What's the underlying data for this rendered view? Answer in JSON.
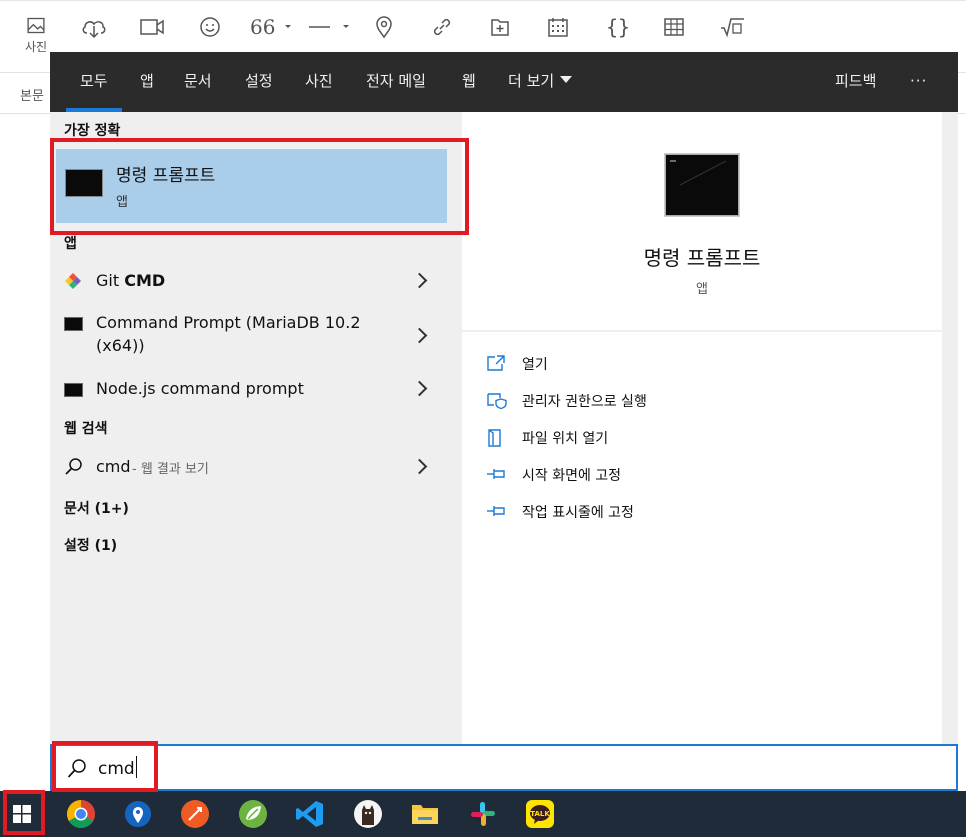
{
  "editor_toolbar": {
    "photo_label": "사진",
    "subbar_label": "본문"
  },
  "start_menu": {
    "tabs": [
      {
        "label": "모두"
      },
      {
        "label": "앱"
      },
      {
        "label": "문서"
      },
      {
        "label": "설정"
      },
      {
        "label": "사진"
      },
      {
        "label": "전자 메일"
      },
      {
        "label": "웹"
      },
      {
        "label": "더 보기"
      }
    ],
    "feedback_label": "피드백",
    "more_label": "···",
    "best_match": {
      "heading": "가장 정확",
      "name": "명령 프롬프트",
      "type": "앱"
    },
    "apps": {
      "heading": "앱",
      "items": [
        {
          "name_prefix": "Git ",
          "name_bold": "CMD"
        },
        {
          "line1": "Command Prompt (MariaDB 10.2",
          "line2": "(x64))"
        },
        {
          "name": "Node.js command prompt"
        }
      ]
    },
    "web_search": {
      "heading": "웹 검색",
      "query": "cmd",
      "suffix": " - 웹 결과 보기"
    },
    "documents_label": "문서 (1+)",
    "settings_label": "설정 (1)",
    "preview": {
      "title": "명령 프롬프트",
      "subtitle": "앱",
      "actions": [
        {
          "label": "열기",
          "icon": "open-icon"
        },
        {
          "label": "관리자 권한으로 실행",
          "icon": "admin-shield-icon"
        },
        {
          "label": "파일 위치 열기",
          "icon": "file-location-icon"
        },
        {
          "label": "시작 화면에 고정",
          "icon": "pin-icon"
        },
        {
          "label": "작업 표시줄에 고정",
          "icon": "pin-icon"
        }
      ]
    }
  },
  "search": {
    "value": "cmd"
  },
  "taskbar": {
    "apps": [
      "chrome-icon",
      "maps-pin-icon",
      "postman-icon",
      "spring-icon",
      "vscode-icon",
      "cat-app-icon",
      "file-explorer-icon",
      "slack-icon",
      "kakaotalk-icon"
    ],
    "kakao_label": "TALK"
  },
  "colors": {
    "accent": "#1a7bd6",
    "highlight": "#aacde9",
    "panel_dark": "#2b2b2b",
    "taskbar": "#1f2b38",
    "annotation_red": "#e01b24"
  }
}
